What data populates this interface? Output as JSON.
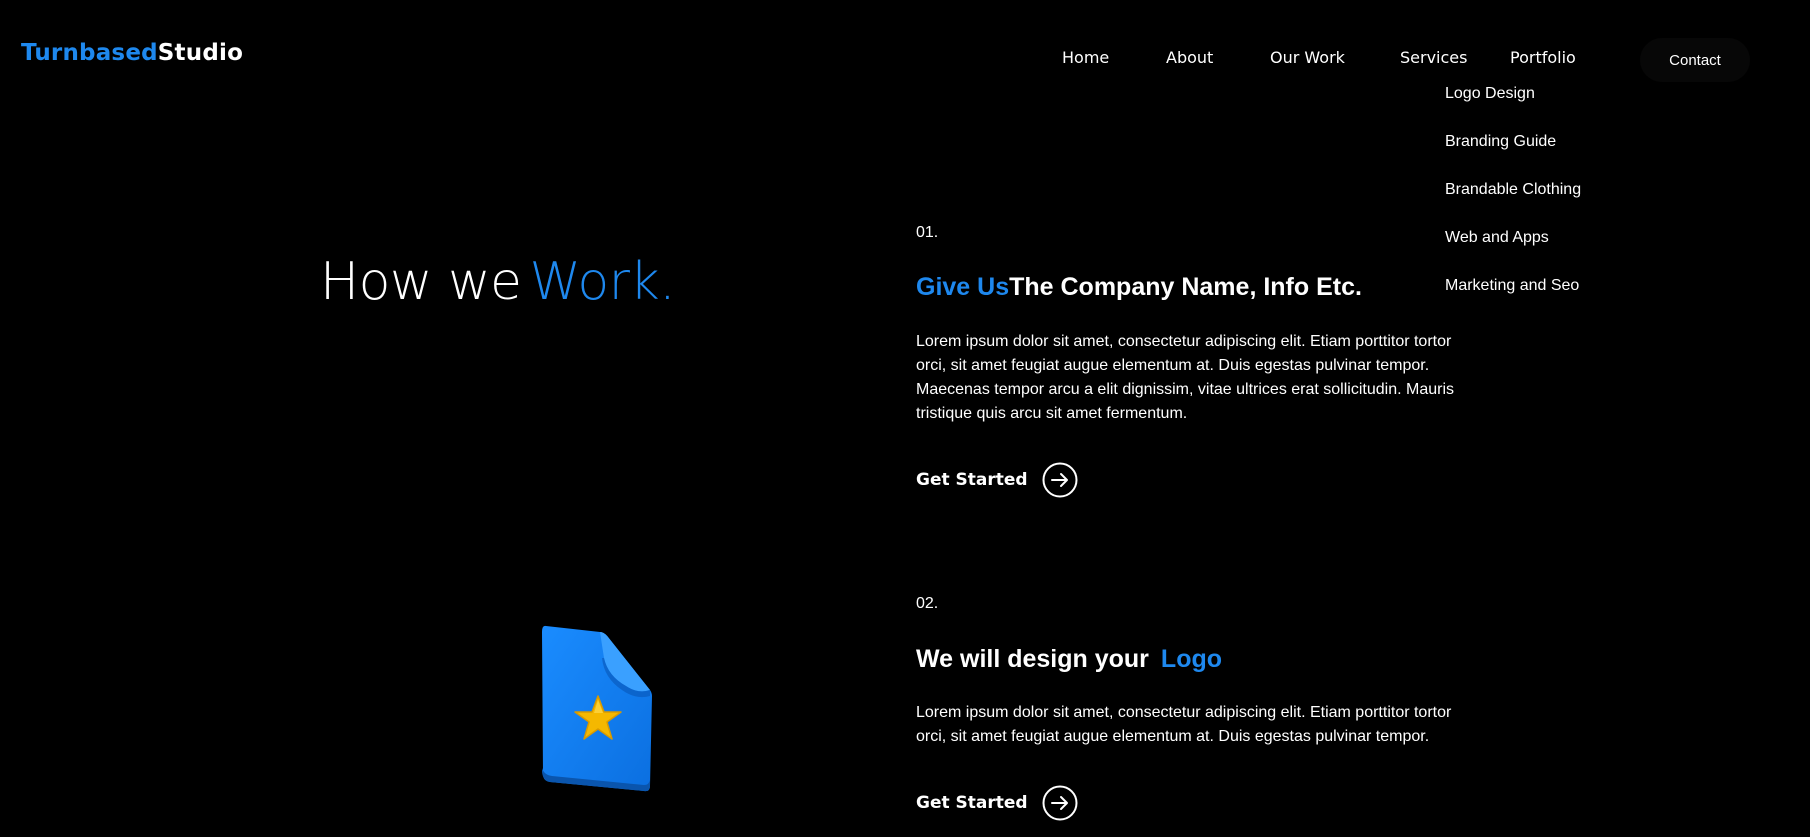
{
  "header": {
    "logo_blue": "Turnbased",
    "logo_white": "Studio",
    "nav": {
      "home": "Home",
      "about": "About",
      "our_work": "Our Work",
      "services": "Services",
      "portfolio": "Portfolio",
      "contact": "Contact"
    }
  },
  "services_dropdown": [
    "Logo Design",
    "Branding Guide",
    "Brandable Clothing",
    "Web and Apps",
    "Marketing and Seo"
  ],
  "hero": {
    "title_white": "How we",
    "title_blue": "Work."
  },
  "steps": [
    {
      "number": "01.",
      "heading_blue": "Give Us",
      "heading_white": "The Company Name, Info Etc.",
      "body": "Lorem ipsum dolor sit amet, consectetur adipiscing elit. Etiam porttitor tortor orci, sit amet feugiat augue elementum at. Duis egestas pulvinar tempor. Maecenas tempor arcu a elit dignissim, vitae ultrices erat sollicitudin. Mauris tristique quis arcu sit amet fermentum.",
      "cta": "Get Started"
    },
    {
      "number": "02.",
      "heading_white": "We will design your",
      "heading_blue": "Logo",
      "body": "Lorem ipsum dolor sit amet, consectetur adipiscing elit. Etiam porttitor tortor orci, sit amet feugiat augue elementum at. Duis egestas pulvinar tempor.",
      "cta": "Get Started"
    }
  ],
  "colors": {
    "accent": "#1e88ee",
    "background": "#000000",
    "text": "#ffffff",
    "star": "#f5b800"
  },
  "icons": {
    "cta": "arrow-right-circle-icon",
    "illustration": "document-star-icon"
  }
}
